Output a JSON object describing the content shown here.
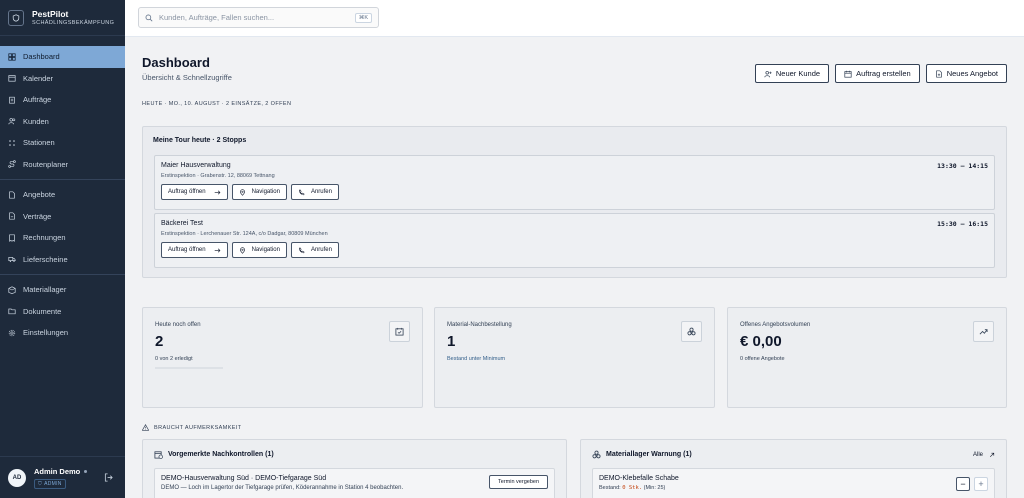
{
  "brand": {
    "name": "PestPilot",
    "tagline": "SCHÄDLINGSBEKÄMPFUNG"
  },
  "search": {
    "placeholder": "Kunden, Aufträge, Fallen suchen...",
    "shortcut": "⌘K"
  },
  "sidebar": {
    "groups": [
      [
        {
          "label": "Dashboard",
          "icon": "home-icon",
          "active": true
        },
        {
          "label": "Kalender",
          "icon": "calendar-icon"
        },
        {
          "label": "Aufträge",
          "icon": "clipboard-icon"
        },
        {
          "label": "Kunden",
          "icon": "users-icon"
        },
        {
          "label": "Stationen",
          "icon": "grid-icon"
        },
        {
          "label": "Routenplaner",
          "icon": "route-icon"
        }
      ],
      [
        {
          "label": "Angebote",
          "icon": "document-icon"
        },
        {
          "label": "Verträge",
          "icon": "contract-icon"
        },
        {
          "label": "Rechnungen",
          "icon": "receipt-icon"
        },
        {
          "label": "Lieferscheine",
          "icon": "truck-icon"
        }
      ],
      [
        {
          "label": "Materiallager",
          "icon": "box-icon"
        },
        {
          "label": "Dokumente",
          "icon": "folder-icon"
        },
        {
          "label": "Einstellungen",
          "icon": "gear-icon"
        }
      ]
    ]
  },
  "user": {
    "initials": "AD",
    "name": "Admin Demo",
    "role": "ADMIN"
  },
  "header": {
    "title": "Dashboard",
    "subtitle": "Übersicht & Schnellzugriffe",
    "date_line": "HEUTE · MO., 10. AUGUST · 2 EINSÄTZE, 2 OFFEN",
    "actions": {
      "new_customer": "Neuer Kunde",
      "new_order": "Auftrag erstellen",
      "new_offer": "Neues Angebot"
    }
  },
  "tour": {
    "title": "Meine Tour heute · 2 Stopps",
    "stops": [
      {
        "name": "Maier Hausverwaltung",
        "time": "13:30 – 14:15",
        "address": "Erstinspektion · Grabenstr. 12, 88069 Tettnang",
        "open": "Auftrag öffnen",
        "nav": "Navigation",
        "call": "Anrufen"
      },
      {
        "name": "Bäckerei Test",
        "time": "15:30 – 16:15",
        "address": "Erstinspektion · Lerchenauer Str. 124A, c/o Dadgar, 80809 München",
        "open": "Auftrag öffnen",
        "nav": "Navigation",
        "call": "Anrufen"
      }
    ]
  },
  "kpis": [
    {
      "label": "Heute noch offen",
      "value": "2",
      "note": "0 von 2 erledigt",
      "progress": 0,
      "icon": "calendar-check-icon"
    },
    {
      "label": "Material-Nachbestellung",
      "value": "1",
      "note": "Bestand unter Minimum",
      "icon": "boxes-icon"
    },
    {
      "label": "Offenes Angebotsvolumen",
      "value": "€ 0,00",
      "note": "0 offene Angebote",
      "icon": "trending-up-icon"
    }
  ],
  "attention": {
    "title": "BRAUCHT AUFMERKSAMKEIT",
    "followups": {
      "title": "Vorgemerkte Nachkontrollen (1)",
      "item_title": "DEMO-Hausverwaltung Süd · DEMO-Tiefgarage Süd",
      "item_desc": "DEMO — Loch im Lagertor der Tiefgarage prüfen, Köderannahme in Station 4 beobachten.",
      "button": "Termin vergeben"
    },
    "stock": {
      "title": "Materiallager Warnung (1)",
      "all": "Alle",
      "item_title": "DEMO-Klebefalle Schabe",
      "stock_label": "Bestand:",
      "stock_value": "0 Stk.",
      "min": "(Min: 25)"
    }
  }
}
